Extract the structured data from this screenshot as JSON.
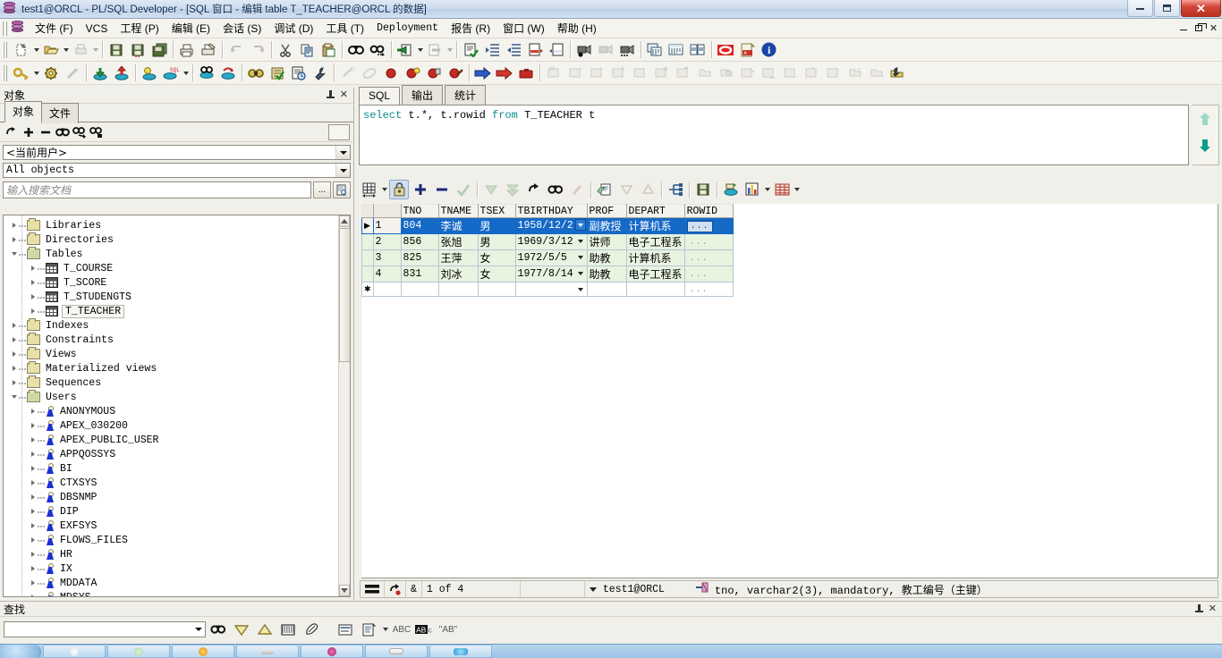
{
  "window": {
    "title": "test1@ORCL - PL/SQL Developer - [SQL 窗口 - 编辑 table T_TEACHER@ORCL 的数据]",
    "app_icon": "database-icon",
    "minimize_label": "最小化",
    "maximize_label": "最大化",
    "close_label": "关闭"
  },
  "menu": {
    "items": [
      {
        "label": "文件 (F)",
        "name": "menu-file"
      },
      {
        "label": "VCS",
        "name": "menu-vcs"
      },
      {
        "label": "工程 (P)",
        "name": "menu-project"
      },
      {
        "label": "编辑 (E)",
        "name": "menu-edit"
      },
      {
        "label": "会话 (S)",
        "name": "menu-session"
      },
      {
        "label": "调试 (D)",
        "name": "menu-debug"
      },
      {
        "label": "工具 (T)",
        "name": "menu-tools"
      },
      {
        "label": "Deployment",
        "name": "menu-deployment"
      },
      {
        "label": "报告 (R)",
        "name": "menu-reports"
      },
      {
        "label": "窗口 (W)",
        "name": "menu-window"
      },
      {
        "label": "帮助 (H)",
        "name": "menu-help"
      }
    ]
  },
  "toolbar_main": {
    "buttons": [
      "new-icon",
      "open-icon",
      "print-preview-icon",
      "save-icon",
      "save-as-icon",
      "save-all-icon",
      "print-icon",
      "print-setup-icon",
      "undo-icon",
      "redo-icon",
      "cut-icon",
      "copy-icon",
      "paste-icon",
      "find-icon",
      "find-next-icon",
      "import-icon",
      "export-icon",
      "validate-icon",
      "indent-icon",
      "outdent-icon",
      "comment-icon",
      "uncomment-icon",
      "record-macro-icon",
      "play-macro-icon",
      "macro-options-icon",
      "window-list-icon",
      "window-tile-icon",
      "window-cascade-icon",
      "oracle-icon",
      "pdf-icon",
      "about-icon"
    ]
  },
  "toolbar_session": {
    "buttons": [
      "key-icon",
      "gear-icon",
      "break-icon",
      "commit-icon",
      "rollback-icon",
      "execute-icon",
      "execute-sql-icon",
      "explain-plan-icon",
      "refresh-session-icon",
      "test-icon",
      "compile-icon",
      "report-icon",
      "wrench-icon",
      "step-disabled-icon",
      "clear-breakpoints-icon",
      "breakpoint-icon",
      "breakpoint-cond-icon",
      "breakpoint-del-icon",
      "breakpoint-edit-icon",
      "step-into-icon",
      "step-over-icon",
      "step-out-icon",
      "object-browser-icon"
    ]
  },
  "objects_panel": {
    "title": "对象",
    "pin_icon": "pin-icon",
    "close_icon": "close-icon",
    "tabs": [
      {
        "label": "对象",
        "active": true,
        "name": "tab-objects"
      },
      {
        "label": "文件",
        "active": false,
        "name": "tab-files"
      }
    ],
    "tool_icons": [
      "refresh-icon",
      "add-icon",
      "remove-icon",
      "find-objects-icon",
      "filter-icon",
      "lock-icon"
    ],
    "user_filter": "<当前用户>",
    "object_filter": "All objects",
    "search_placeholder": "输入搜索文档",
    "search_browse_label": "...",
    "search_options_icon": "document-search-icon",
    "tree": [
      {
        "label": "Libraries",
        "indent": 0,
        "icon": "folder-icon",
        "expander": "collapsed"
      },
      {
        "label": "Directories",
        "indent": 0,
        "icon": "folder-icon",
        "expander": "collapsed"
      },
      {
        "label": "Tables",
        "indent": 0,
        "icon": "folder-open-icon",
        "expander": "expanded"
      },
      {
        "label": "T_COURSE",
        "indent": 1,
        "icon": "table-icon",
        "expander": "collapsed"
      },
      {
        "label": "T_SCORE",
        "indent": 1,
        "icon": "table-icon",
        "expander": "collapsed"
      },
      {
        "label": "T_STUDENGTS",
        "indent": 1,
        "icon": "table-icon",
        "expander": "collapsed"
      },
      {
        "label": "T_TEACHER",
        "indent": 1,
        "icon": "table-icon",
        "expander": "collapsed",
        "selected": true
      },
      {
        "label": "Indexes",
        "indent": 0,
        "icon": "folder-icon",
        "expander": "collapsed"
      },
      {
        "label": "Constraints",
        "indent": 0,
        "icon": "folder-icon",
        "expander": "collapsed"
      },
      {
        "label": "Views",
        "indent": 0,
        "icon": "folder-icon",
        "expander": "collapsed"
      },
      {
        "label": "Materialized views",
        "indent": 0,
        "icon": "folder-icon",
        "expander": "collapsed"
      },
      {
        "label": "Sequences",
        "indent": 0,
        "icon": "folder-icon",
        "expander": "collapsed"
      },
      {
        "label": "Users",
        "indent": 0,
        "icon": "folder-open-icon",
        "expander": "expanded"
      },
      {
        "label": "ANONYMOUS",
        "indent": 1,
        "icon": "user-icon",
        "expander": "collapsed"
      },
      {
        "label": "APEX_030200",
        "indent": 1,
        "icon": "user-icon",
        "expander": "collapsed"
      },
      {
        "label": "APEX_PUBLIC_USER",
        "indent": 1,
        "icon": "user-icon",
        "expander": "collapsed"
      },
      {
        "label": "APPQOSSYS",
        "indent": 1,
        "icon": "user-icon",
        "expander": "collapsed"
      },
      {
        "label": "BI",
        "indent": 1,
        "icon": "user-icon",
        "expander": "collapsed"
      },
      {
        "label": "CTXSYS",
        "indent": 1,
        "icon": "user-icon",
        "expander": "collapsed"
      },
      {
        "label": "DBSNMP",
        "indent": 1,
        "icon": "user-icon",
        "expander": "collapsed"
      },
      {
        "label": "DIP",
        "indent": 1,
        "icon": "user-icon",
        "expander": "collapsed"
      },
      {
        "label": "EXFSYS",
        "indent": 1,
        "icon": "user-icon",
        "expander": "collapsed"
      },
      {
        "label": "FLOWS_FILES",
        "indent": 1,
        "icon": "user-icon",
        "expander": "collapsed"
      },
      {
        "label": "HR",
        "indent": 1,
        "icon": "user-icon",
        "expander": "collapsed"
      },
      {
        "label": "IX",
        "indent": 1,
        "icon": "user-icon",
        "expander": "collapsed"
      },
      {
        "label": "MDDATA",
        "indent": 1,
        "icon": "user-icon",
        "expander": "collapsed"
      },
      {
        "label": "MDSYS",
        "indent": 1,
        "icon": "user-icon",
        "expander": "collapsed"
      }
    ]
  },
  "sql_window": {
    "tabs": [
      {
        "label": "SQL",
        "active": true,
        "name": "tab-sql"
      },
      {
        "label": "输出",
        "active": false,
        "name": "tab-output"
      },
      {
        "label": "统计",
        "active": false,
        "name": "tab-statistics"
      }
    ],
    "query_tokens": [
      {
        "text": "select ",
        "kind": "keyword"
      },
      {
        "text": "t.*, t.rowid ",
        "kind": "plain"
      },
      {
        "text": "from ",
        "kind": "keyword"
      },
      {
        "text": "T_TEACHER t",
        "kind": "plain"
      }
    ],
    "query_text": "select t.*, t.rowid from T_TEACHER t",
    "scroll_up_icon": "arrow-up-icon",
    "scroll_down_icon": "arrow-down-icon"
  },
  "grid_toolbar": {
    "buttons": [
      "grid-layout-icon",
      "grid-layout-dropdown",
      "lock-record-icon",
      "insert-record-icon",
      "delete-record-icon",
      "post-changes-icon",
      "next-set-icon",
      "fetch-all-icon",
      "refresh-icon",
      "find-icon",
      "undo-changes-icon",
      "copy-data-icon",
      "sort-desc-icon",
      "sort-asc-icon",
      "flow-icon",
      "save-grid-icon",
      "export-db-icon",
      "chart-icon",
      "chart-dropdown",
      "single-record-icon",
      "single-record-dropdown"
    ]
  },
  "data_grid": {
    "columns": [
      "TNO",
      "TNAME",
      "TSEX",
      "TBIRTHDAY",
      "PROF",
      "DEPART",
      "ROWID"
    ],
    "rows": [
      {
        "n": "1",
        "TNO": "804",
        "TNAME": "李诚",
        "TSEX": "男",
        "TBIRTHDAY": "1958/12/2",
        "PROF": "副教授",
        "DEPART": "计算机系",
        "ROWID": "...",
        "selected": true
      },
      {
        "n": "2",
        "TNO": "856",
        "TNAME": "张旭",
        "TSEX": "男",
        "TBIRTHDAY": "1969/3/12",
        "PROF": "讲师",
        "DEPART": "电子工程系",
        "ROWID": "..."
      },
      {
        "n": "3",
        "TNO": "825",
        "TNAME": "王萍",
        "TSEX": "女",
        "TBIRTHDAY": "1972/5/5",
        "PROF": "助教",
        "DEPART": "计算机系",
        "ROWID": "..."
      },
      {
        "n": "4",
        "TNO": "831",
        "TNAME": "刘冰",
        "TSEX": "女",
        "TBIRTHDAY": "1977/8/14",
        "PROF": "助教",
        "DEPART": "电子工程系",
        "ROWID": "..."
      }
    ],
    "new_row_marker": "✱"
  },
  "grid_status": {
    "layout_icon": "rows-icon",
    "refresh_icon": "refresh-red-icon",
    "lock_icon": "ampersand-icon",
    "lock_label": "&",
    "record_position": "1 of 4",
    "connection_dropdown_icon": "chevron-down-icon",
    "connection": "test1@ORCL",
    "key_icon": "primary-key-icon",
    "column_info": "tno, varchar2(3), mandatory, 教工编号（主键）"
  },
  "find_bar": {
    "title": "查找",
    "pin_icon": "pin-icon",
    "close_icon": "close-icon",
    "search_value": "",
    "icons": [
      "find-icon",
      "find-down-icon",
      "find-up-icon",
      "find-all-icon",
      "highlight-icon",
      "in-selection-icon",
      "multiline-icon",
      "multiline-dropdown",
      "regex-abc-icon",
      "case-sensitive-icon",
      "whole-word-icon"
    ],
    "labels": {
      "abc": "ABC",
      "case": "AB",
      "word": "\"AB\""
    }
  },
  "taskbar": {
    "start_label": "",
    "tasks": [
      "",
      "",
      "",
      "",
      "",
      "",
      ""
    ]
  },
  "colors": {
    "selection": "#1569c7",
    "alt_row": "#e8f3e0",
    "keyword": "#0b8a8a",
    "titlebar": "#cfdcee",
    "chrome": "#f0efe9"
  }
}
